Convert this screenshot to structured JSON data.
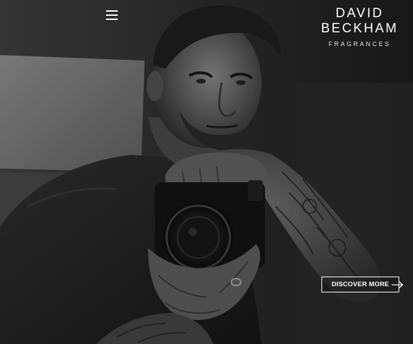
{
  "header": {
    "menu_icon": "hamburger-menu-icon",
    "brand": {
      "line1": "DAVID",
      "line2": "BECKHAM",
      "subline": "FRAGRANCES"
    }
  },
  "hero": {
    "image": "black-and-white photo of a tattooed man holding a camera",
    "cta_label": "DISCOVER MORE",
    "cta_icon": "arrow-right-icon"
  },
  "colors": {
    "text": "#ffffff",
    "background": "#1e1e1e"
  }
}
